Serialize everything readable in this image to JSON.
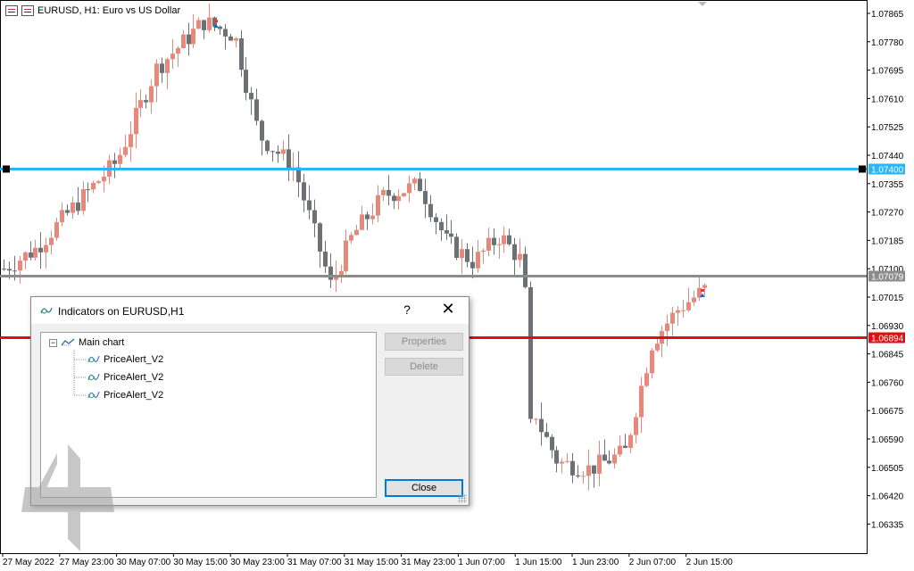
{
  "chart": {
    "title": "EURUSD, H1:  Euro vs US Dollar",
    "symbol_icon": "symbol-icons",
    "price_axis": [
      "1.07865",
      "1.07780",
      "1.07695",
      "1.07610",
      "1.07525",
      "1.07440",
      "1.07355",
      "1.07270",
      "1.07185",
      "1.07100",
      "1.07015",
      "1.06930",
      "1.06845",
      "1.06760",
      "1.06675",
      "1.06590",
      "1.06505",
      "1.06420",
      "1.06335"
    ],
    "time_axis": [
      "27 May 2022",
      "27 May 23:00",
      "30 May 07:00",
      "30 May 15:00",
      "30 May 23:00",
      "31 May 07:00",
      "31 May 15:00",
      "31 May 23:00",
      "1 Jun 07:00",
      "1 Jun 15:00",
      "1 Jun 23:00",
      "2 Jun 07:00",
      "2 Jun 15:00"
    ],
    "lines": [
      {
        "name": "price-alert-line-upper",
        "price": 1.074,
        "label": "1.07400",
        "color": "#29b6f6"
      },
      {
        "name": "current-price-line",
        "price": 1.07079,
        "label": "1.07079",
        "color": "#8c8c8c"
      },
      {
        "name": "price-alert-line-lower",
        "price": 1.06894,
        "label": "1.06894",
        "color": "#e01010"
      }
    ],
    "bull_color": "#e8887a",
    "bear_color": "#6d7075"
  },
  "dialog": {
    "title": "Indicators on EURUSD,H1",
    "help": "?",
    "close_glyph": "✕",
    "tree_root": "Main chart",
    "indicators": [
      "PriceAlert_V2",
      "PriceAlert_V2",
      "PriceAlert_V2"
    ],
    "buttons": {
      "properties": "Properties",
      "delete": "Delete",
      "close": "Close"
    }
  }
}
